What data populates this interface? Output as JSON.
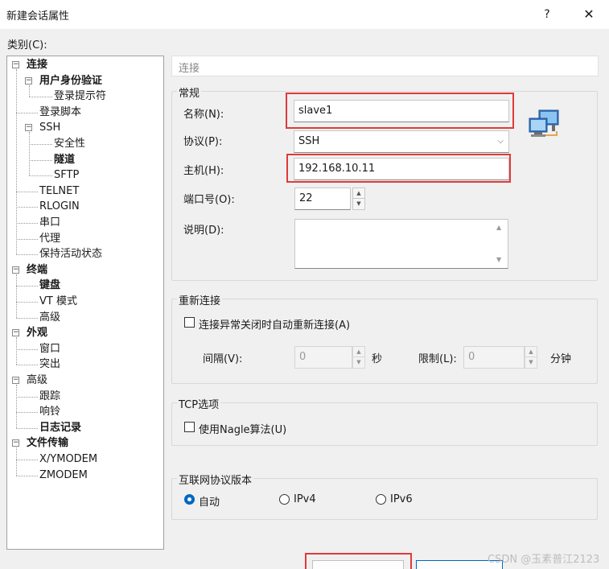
{
  "window": {
    "title": "新建会话属性",
    "help_label": "?",
    "close_label": "✕"
  },
  "category_label": "类别(C):",
  "tree": {
    "items": [
      {
        "label": "连接",
        "level": 0,
        "bold": true,
        "toggle": "−"
      },
      {
        "label": "用户身份验证",
        "level": 1,
        "bold": true,
        "toggle": "−"
      },
      {
        "label": "登录提示符",
        "level": 2,
        "bold": false
      },
      {
        "label": "登录脚本",
        "level": 1,
        "bold": false
      },
      {
        "label": "SSH",
        "level": 1,
        "bold": false,
        "toggle": "−"
      },
      {
        "label": "安全性",
        "level": 2,
        "bold": false
      },
      {
        "label": "隧道",
        "level": 2,
        "bold": true
      },
      {
        "label": "SFTP",
        "level": 2,
        "bold": false
      },
      {
        "label": "TELNET",
        "level": 1,
        "bold": false
      },
      {
        "label": "RLOGIN",
        "level": 1,
        "bold": false
      },
      {
        "label": "串口",
        "level": 1,
        "bold": false
      },
      {
        "label": "代理",
        "level": 1,
        "bold": false
      },
      {
        "label": "保持活动状态",
        "level": 1,
        "bold": false
      },
      {
        "label": "终端",
        "level": 0,
        "bold": true,
        "toggle": "−"
      },
      {
        "label": "键盘",
        "level": 1,
        "bold": true
      },
      {
        "label": "VT 模式",
        "level": 1,
        "bold": false
      },
      {
        "label": "高级",
        "level": 1,
        "bold": false
      },
      {
        "label": "外观",
        "level": 0,
        "bold": true,
        "toggle": "−"
      },
      {
        "label": "窗口",
        "level": 1,
        "bold": false
      },
      {
        "label": "突出",
        "level": 1,
        "bold": false
      },
      {
        "label": "高级",
        "level": 0,
        "bold": false,
        "toggle": "−"
      },
      {
        "label": "跟踪",
        "level": 1,
        "bold": false
      },
      {
        "label": "响铃",
        "level": 1,
        "bold": false
      },
      {
        "label": "日志记录",
        "level": 1,
        "bold": true
      },
      {
        "label": "文件传输",
        "level": 0,
        "bold": true,
        "toggle": "−"
      },
      {
        "label": "X/YMODEM",
        "level": 1,
        "bold": false
      },
      {
        "label": "ZMODEM",
        "level": 1,
        "bold": false
      }
    ]
  },
  "section_header": "连接",
  "general": {
    "title": "常规",
    "name_label": "名称(N):",
    "name_value": "slave1",
    "protocol_label": "协议(P):",
    "protocol_value": "SSH",
    "host_label": "主机(H):",
    "host_value": "192.168.10.11",
    "port_label": "端口号(O):",
    "port_value": "22",
    "desc_label": "说明(D):",
    "desc_value": ""
  },
  "reconnect": {
    "title": "重新连接",
    "auto_label": "连接异常关闭时自动重新连接(A)",
    "interval_label": "间隔(V):",
    "interval_value": "0",
    "interval_unit": "秒",
    "limit_label": "限制(L):",
    "limit_value": "0",
    "limit_unit": "分钟"
  },
  "tcp": {
    "title": "TCP选项",
    "nagle_label": "使用Nagle算法(U)"
  },
  "ip_version": {
    "title": "互联网协议版本",
    "options": [
      "自动",
      "IPv4",
      "IPv6"
    ],
    "selected": "自动"
  },
  "watermark": "CSDN @玉素普江2123",
  "colors": {
    "highlight": "#e03a3a",
    "radio_selected": "#0067c0"
  }
}
